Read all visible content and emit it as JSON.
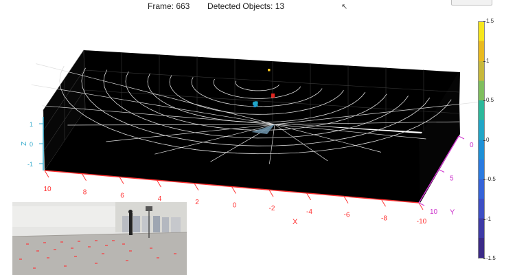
{
  "header": {
    "frame_label": "Frame: 663",
    "objects_label": "Detected Objects: 13"
  },
  "axes": {
    "x_label": "X",
    "y_label": "Y",
    "z_label": "Z",
    "x_ticks": [
      "10",
      "8",
      "6",
      "4",
      "2",
      "0",
      "-2",
      "-4",
      "-6",
      "-8",
      "-10"
    ],
    "y_ticks": [
      "0",
      "5",
      "10"
    ],
    "z_ticks": [
      "1",
      "0",
      "-1"
    ]
  },
  "colorbar": {
    "ticks": [
      "1.5",
      "1",
      "0.5",
      "0",
      "-0.5",
      "-1",
      "-1.5"
    ]
  },
  "colors": {
    "plot_background": "#000000",
    "x_axis": "#ff3333",
    "y_axis": "#cc33cc",
    "z_axis": "#33aacc",
    "grid": "#ffffff"
  },
  "chart_data": {
    "type": "scatter",
    "xlim": [
      -10,
      10
    ],
    "ylim": [
      0,
      10
    ],
    "zlim": [
      -1,
      1
    ],
    "color_range": [
      -1.5,
      1.5
    ],
    "grid": true,
    "points": [
      {
        "x": 0.0,
        "y": 0.3,
        "z": 1.2
      },
      {
        "x": 0.2,
        "y": 1.0,
        "z": 0.6
      },
      {
        "x": 1.2,
        "y": 2.5,
        "z": 0.1
      },
      {
        "x": 1.1,
        "y": 2.6,
        "z": 0.15
      },
      {
        "x": 1.3,
        "y": 2.4,
        "z": 0.05
      },
      {
        "x": 1.0,
        "y": 2.7,
        "z": 0.1
      },
      {
        "x": 1.2,
        "y": 2.8,
        "z": 0.2
      },
      {
        "x": 1.4,
        "y": 2.6,
        "z": 0.0
      },
      {
        "x": 1.15,
        "y": 2.55,
        "z": -0.05
      },
      {
        "x": 1.25,
        "y": 2.65,
        "z": 0.12
      },
      {
        "x": 1.05,
        "y": 2.45,
        "z": 0.08
      },
      {
        "x": 1.35,
        "y": 2.75,
        "z": 0.18
      },
      {
        "x": 1.2,
        "y": 2.9,
        "z": 0.05
      }
    ]
  }
}
